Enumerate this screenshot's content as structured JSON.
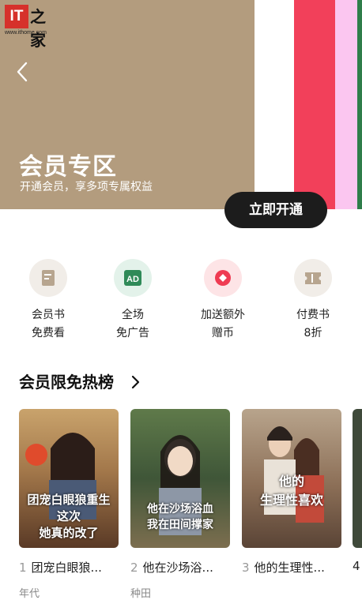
{
  "watermark": {
    "brand_cn": "之家",
    "url": "www.ithome.com",
    "brand_it": "IT"
  },
  "hero": {
    "title": "会员专区",
    "subtitle": "开通会员，享多项专属权益",
    "button": "立即开通",
    "stripe_colors": [
      "#ffffff",
      "#f2405a",
      "#fbc6f0",
      "#2f7d4a"
    ]
  },
  "benefits": [
    {
      "line1": "会员书",
      "line2": "免费看",
      "icon": "book-icon",
      "bg": "#f1ede8"
    },
    {
      "line1": "全场",
      "line2": "免广告",
      "icon": "ad-icon",
      "bg": "#e3f2ea"
    },
    {
      "line1": "加送额外",
      "line2": "赠币",
      "icon": "coin-icon",
      "bg": "#fde4e6"
    },
    {
      "line1": "付费书",
      "line2": "8折",
      "icon": "ticket-icon",
      "bg": "#f1ede8"
    }
  ],
  "ad_text": "AD",
  "section": {
    "title": "会员限免热榜"
  },
  "books": [
    {
      "rank": "1",
      "title": "团宠白眼狼...",
      "genre": "年代",
      "cover_text": "团宠白眼狼重生 这次 她真的改了"
    },
    {
      "rank": "2",
      "title": "他在沙场浴...",
      "genre": "种田",
      "cover_text": "他在沙场浴血 我在田间撑家"
    },
    {
      "rank": "3",
      "title": "他的生理性...",
      "genre": "",
      "cover_text": "他的 生理性喜欢"
    },
    {
      "rank": "4",
      "title": "",
      "genre": "",
      "cover_text": ""
    }
  ]
}
